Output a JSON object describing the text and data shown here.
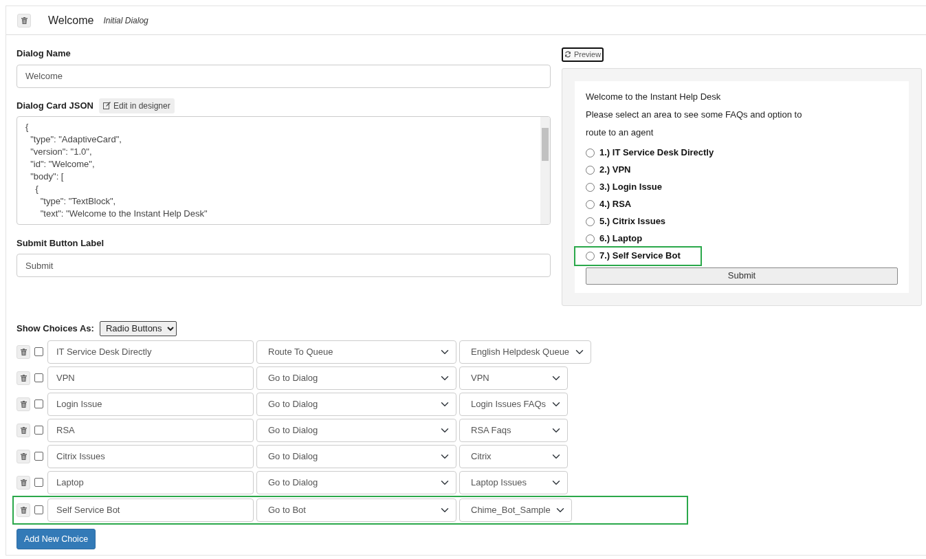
{
  "header": {
    "title": "Welcome",
    "subtitle": "Initial Dialog"
  },
  "dialog_name": {
    "label": "Dialog Name",
    "value": "Welcome"
  },
  "card_json": {
    "label": "Dialog Card JSON",
    "designer_button": "Edit in designer",
    "lines": [
      "{",
      "  \"type\": \"AdaptiveCard\",",
      "  \"version\": \"1.0\",",
      "  \"id\": \"Welcome\",",
      "  \"body\": [",
      "    {",
      "      \"type\": \"TextBlock\",",
      "      \"text\": \"Welcome to the Instant Help Desk\""
    ]
  },
  "submit_label": {
    "label": "Submit Button Label",
    "value": "Submit"
  },
  "preview": {
    "button": "Preview",
    "texts": [
      "Welcome to the Instant Help Desk",
      "Please select an area to see some FAQs and option to",
      "route to an agent"
    ],
    "options": [
      {
        "label": "1.) IT Service Desk Directly",
        "selected": false,
        "highlighted": false
      },
      {
        "label": "2.) VPN",
        "selected": false,
        "highlighted": false
      },
      {
        "label": "3.) Login Issue",
        "selected": false,
        "highlighted": false
      },
      {
        "label": "4.) RSA",
        "selected": false,
        "highlighted": false
      },
      {
        "label": "5.) Citrix Issues",
        "selected": false,
        "highlighted": false
      },
      {
        "label": "6.) Laptop",
        "selected": false,
        "highlighted": false
      },
      {
        "label": "7.) Self Service Bot",
        "selected": false,
        "highlighted": true
      }
    ],
    "submit": "Submit"
  },
  "show_choices": {
    "label": "Show Choices As:",
    "value": "Radio Buttons"
  },
  "choices": [
    {
      "checked": false,
      "text": "IT Service Desk Directly",
      "action": "Route To Queue",
      "target": "English Helpdesk Queue",
      "highlighted": false
    },
    {
      "checked": false,
      "text": "VPN",
      "action": "Go to Dialog",
      "target": "VPN",
      "highlighted": false
    },
    {
      "checked": false,
      "text": "Login Issue",
      "action": "Go to Dialog",
      "target": "Login Issues FAQs",
      "highlighted": false
    },
    {
      "checked": false,
      "text": "RSA",
      "action": "Go to Dialog",
      "target": "RSA Faqs",
      "highlighted": false
    },
    {
      "checked": false,
      "text": "Citrix Issues",
      "action": "Go to Dialog",
      "target": "Citrix",
      "highlighted": false
    },
    {
      "checked": false,
      "text": "Laptop",
      "action": "Go to Dialog",
      "target": "Laptop Issues",
      "highlighted": false
    },
    {
      "checked": false,
      "text": "Self Service Bot",
      "action": "Go to Bot",
      "target": "Chime_Bot_Sample",
      "highlighted": true
    }
  ],
  "add_button": "Add New Choice"
}
